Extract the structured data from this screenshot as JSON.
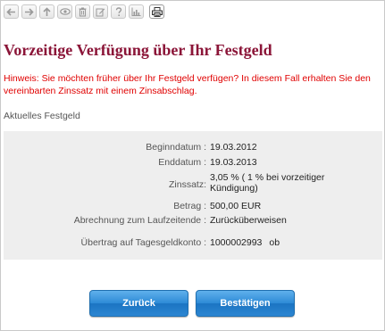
{
  "toolbar": {
    "icons": [
      "back-arrow-icon",
      "forward-arrow-icon",
      "up-arrow-icon",
      "eye-icon",
      "trash-icon",
      "edit-icon",
      "help-icon",
      "chart-icon",
      "print-icon"
    ]
  },
  "page": {
    "title": "Vorzeitige Verfügung über Ihr Festgeld",
    "hint": "Hinweis: Sie möchten früher über Ihr Festgeld verfügen? In diesem Fall erhalten Sie den vereinbarten Zinssatz mit einem Zinsabschlag.",
    "section_label": "Aktuelles Festgeld"
  },
  "details": {
    "begin_label": "Beginndatum :",
    "begin_value": "19.03.2012",
    "end_label": "Enddatum :",
    "end_value": "19.03.2013",
    "rate_label": "Zinssatz:",
    "rate_value": "3,05 %   ( 1 % bei vorzeitiger Kündigung)",
    "amount_label": "Betrag :",
    "amount_value": "500,00 EUR",
    "settlement_label": "Abrechnung zum Laufzeitende :",
    "settlement_value": "Zurücküberweisen",
    "transfer_label": "Übertrag auf Tagesgeldkonto :",
    "transfer_account": "1000002993",
    "transfer_suffix": "ob"
  },
  "buttons": {
    "back": "Zurück",
    "confirm": "Bestätigen"
  },
  "colors": {
    "title": "#8b1538",
    "hint": "#e00000",
    "panel": "#eeeeee",
    "button": "#2d8ad6"
  }
}
